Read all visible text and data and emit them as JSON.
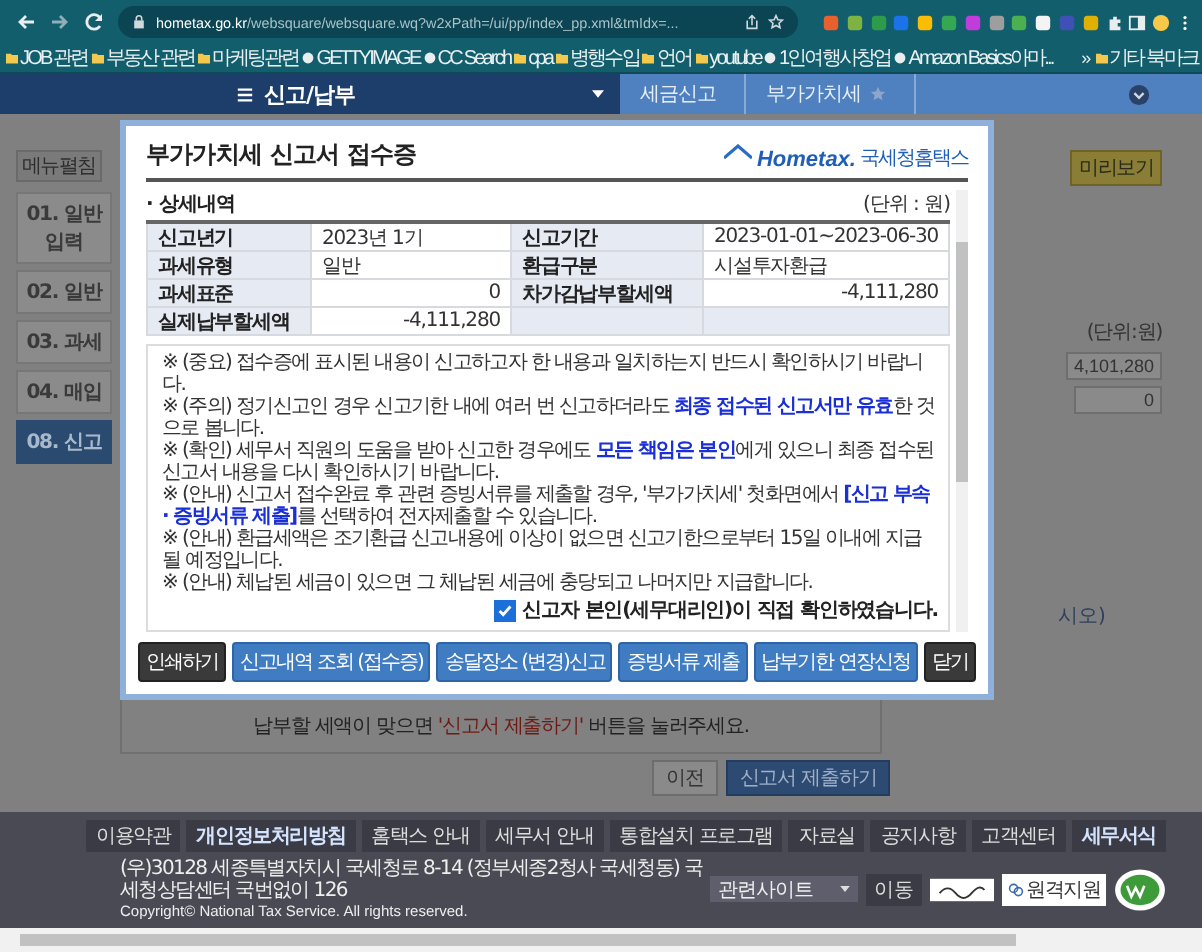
{
  "browser": {
    "url_host": "hometax.go.kr",
    "url_path": "/websquare/websquare.wq?w2xPath=/ui/pp/index_pp.xml&tmIdx=...",
    "bookmarks": [
      {
        "label": "JOB 관련",
        "kind": "folder"
      },
      {
        "label": "부동산 관련",
        "kind": "folder"
      },
      {
        "label": "마케팅관련",
        "kind": "folder"
      },
      {
        "label": "GETTYIMAGE",
        "kind": "site"
      },
      {
        "label": "CC Search",
        "kind": "site"
      },
      {
        "label": "cpa",
        "kind": "folder"
      },
      {
        "label": "병행수입",
        "kind": "folder"
      },
      {
        "label": "언어",
        "kind": "folder"
      },
      {
        "label": "youtube",
        "kind": "folder"
      },
      {
        "label": "1인여행사창업",
        "kind": "site"
      },
      {
        "label": "Amazon Basics아마...",
        "kind": "site"
      }
    ],
    "overflow": "»",
    "other_bookmarks": "기타 북마크"
  },
  "nav": {
    "menu": "신고/납부",
    "breadcrumbs": [
      "세금신고",
      "부가가치세"
    ]
  },
  "page": {
    "menu_toggle": "메뉴펼침",
    "steps": [
      {
        "lines": [
          "01. 일반",
          "입력"
        ],
        "selected": false
      },
      {
        "lines": [
          "02. 일반"
        ],
        "selected": false
      },
      {
        "lines": [
          "03. 과세"
        ],
        "selected": false
      },
      {
        "lines": [
          "04. 매입"
        ],
        "selected": false
      },
      {
        "lines": [
          "08. 신고"
        ],
        "selected": true
      }
    ],
    "preview_button": "미리보기",
    "unit": "(단위:원)",
    "amounts": [
      "4,101,280",
      "0"
    ],
    "hint_tail": "시오)",
    "submit_hint": {
      "before": "납부할 세액이 맞으면 ",
      "highlight": "'신고서 제출하기'",
      "after": " 버튼을 눌러주세요."
    },
    "buttons": [
      {
        "label": "이전",
        "kind": "plain"
      },
      {
        "label": "신고서 제출하기",
        "kind": "primary"
      }
    ]
  },
  "modal": {
    "title": "부가가치세 신고서 접수증",
    "logo": {
      "brand": "Hometax.",
      "subtitle": "국세청홈택스"
    },
    "section": "· 상세내역",
    "unit": "(단위 : 원)",
    "rows": [
      {
        "label1": "신고년기",
        "value1": {
          "text": "2023년 1기",
          "kind": "text"
        },
        "label2": "신고기간",
        "value2": {
          "text": "2023-01-01~2023-06-30",
          "kind": "text"
        }
      },
      {
        "label1": "과세유형",
        "value1": {
          "text": "일반",
          "kind": "text"
        },
        "label2": "환급구분",
        "value2": {
          "text": "시설투자환급",
          "kind": "text"
        }
      },
      {
        "label1": "과세표준",
        "value1": {
          "text": "0",
          "kind": "amount"
        },
        "label2": "차가감납부할세액",
        "value2": {
          "text": "-4,111,280",
          "kind": "amount"
        }
      },
      {
        "label1": "실제납부할세액",
        "value1": {
          "text": "-4,111,280",
          "kind": "amount"
        }
      }
    ],
    "notices": [
      "※ (중요) 접수증에 표시된 내용이 신고하고자 한 내용과 일치하는지 반드시 확인하시기 바랍니다.",
      "※ (주의) 정기신고인 경우 신고기한 내에 여러 번 신고하더라도 **최종 접수된 신고서만 유효**한 것으로 봅니다.",
      "※ (확인) 세무서 직원의 도움을 받아 신고한 경우에도 **모든 책임은 본인**에게 있으니 최종 접수된 신고서 내용을 다시 확인하시기 바랍니다.",
      "※ (안내) 신고서 접수완료 후 관련 증빙서류를 제출할 경우, '부가가치세' 첫화면에서 **[신고 부속 · 증빙서류 제출]**를 선택하여 전자제출할 수 있습니다.",
      "※ (안내) 환급세액은 조기환급 신고내용에 이상이 없으면 신고기한으로부터 15일 이내에 지급될 예정입니다.",
      "※ (안내) 체납된 세금이 있으면 그 체납된 세금에 충당되고 나머지만 지급합니다."
    ],
    "confirm": {
      "label": "신고자 본인(세무대리인)이 직접 확인하였습니다.",
      "checked": true
    },
    "buttons": [
      {
        "label": "인쇄하기",
        "kind": "dark"
      },
      {
        "label": "신고내역 조회 (접수증)",
        "kind": "primary"
      },
      {
        "label": "송달장소 (변경)신고",
        "kind": "primary"
      },
      {
        "label": "증빙서류 제출",
        "kind": "primary"
      },
      {
        "label": "납부기한 연장신청",
        "kind": "primary"
      },
      {
        "label": "닫기",
        "kind": "dark"
      }
    ]
  },
  "footer": {
    "links": [
      {
        "label": "이용약관",
        "emphasis": false
      },
      {
        "label": "개인정보처리방침",
        "emphasis": true
      },
      {
        "label": "홈택스 안내",
        "emphasis": false
      },
      {
        "label": "세무서 안내",
        "emphasis": false
      },
      {
        "label": "통합설치 프로그램",
        "emphasis": false
      },
      {
        "label": "자료실",
        "emphasis": false
      },
      {
        "label": "공지사항",
        "emphasis": false
      },
      {
        "label": "고객센터",
        "emphasis": false
      },
      {
        "label": "세무서식",
        "emphasis": true
      }
    ],
    "address": "(우)30128 세종특별자치시 국세청로 8-14 (정부세종2청사 국세청동) 국세청상담센터 국번없이 126",
    "copyright": "Copyright© National Tax Service. All rights reserved.",
    "related_select": "관련사이트",
    "go_button": "이동",
    "remote_button": "원격지원"
  }
}
